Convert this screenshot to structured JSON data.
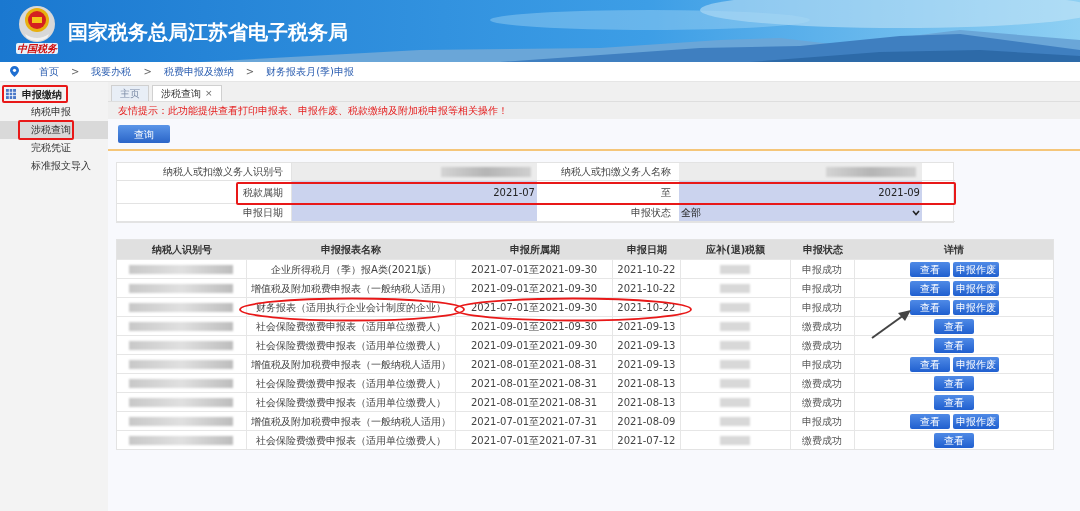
{
  "header": {
    "title": "国家税务总局江苏省电子税务局",
    "emblem_caption": "中国税务"
  },
  "breadcrumb": [
    {
      "label": "首页",
      "kind": "link"
    },
    {
      "label": ">",
      "kind": "separator"
    },
    {
      "label": "我要办税",
      "kind": "link"
    },
    {
      "label": ">",
      "kind": "separator"
    },
    {
      "label": "税费申报及缴纳",
      "kind": "link"
    },
    {
      "label": ">",
      "kind": "separator"
    },
    {
      "label": "财务报表月(季)申报",
      "kind": "link"
    }
  ],
  "sidebar": {
    "title": "申报缴纳",
    "items": [
      {
        "label": "纳税申报",
        "selected": false
      },
      {
        "label": "涉税查询",
        "selected": true
      },
      {
        "label": "完税凭证",
        "selected": false
      },
      {
        "label": "标准报文导入",
        "selected": false
      }
    ]
  },
  "tabs": [
    {
      "label": "主页",
      "selected": false
    },
    {
      "label": "涉税查询",
      "selected": true,
      "close": "×"
    }
  ],
  "notice": "友情提示：此功能提供查看打印申报表、申报作废、税款缴纳及附加税申报等相关操作！",
  "query_button": "查询",
  "form": {
    "rows": [
      [
        {
          "label": "纳税人或扣缴义务人识别号",
          "kind": "redacted"
        },
        {
          "label": "纳税人或扣缴义务人名称",
          "kind": "redacted"
        }
      ],
      [
        {
          "label": "税款属期",
          "kind": "input",
          "value": "2021-07"
        },
        {
          "label": "至",
          "kind": "input",
          "value": "2021-09"
        }
      ],
      [
        {
          "label": "申报日期",
          "kind": "input"
        },
        {
          "label": "申报状态",
          "kind": "select",
          "value": "全部"
        }
      ]
    ]
  },
  "table": {
    "columns": [
      "纳税人识别号",
      "申报报表名称",
      "申报所属期",
      "申报日期",
      "应补(退)税额",
      "申报状态",
      "详情"
    ],
    "rows": [
      {
        "name": "企业所得税月（季）报A类(2021版)",
        "period": "2021-07-01至2021-09-30",
        "date": "2021-10-22",
        "status": "申报成功",
        "buttons": [
          "查看",
          "申报作废"
        ]
      },
      {
        "name": "增值税及附加税费申报表（一般纳税人适用）",
        "period": "2021-09-01至2021-09-30",
        "date": "2021-10-22",
        "status": "申报成功",
        "buttons": [
          "查看",
          "申报作废"
        ]
      },
      {
        "name": "财务报表（适用执行企业会计制度的企业）",
        "period": "2021-07-01至2021-09-30",
        "date": "2021-10-22",
        "status": "申报成功",
        "buttons": [
          "查看",
          "申报作废"
        ]
      },
      {
        "name": "社会保险费缴费申报表（适用单位缴费人）",
        "period": "2021-09-01至2021-09-30",
        "date": "2021-09-13",
        "status": "缴费成功",
        "buttons": [
          "查看"
        ]
      },
      {
        "name": "社会保险费缴费申报表（适用单位缴费人）",
        "period": "2021-09-01至2021-09-30",
        "date": "2021-09-13",
        "status": "缴费成功",
        "buttons": [
          "查看"
        ]
      },
      {
        "name": "增值税及附加税费申报表（一般纳税人适用）",
        "period": "2021-08-01至2021-08-31",
        "date": "2021-09-13",
        "status": "申报成功",
        "buttons": [
          "查看",
          "申报作废"
        ]
      },
      {
        "name": "社会保险费缴费申报表（适用单位缴费人）",
        "period": "2021-08-01至2021-08-31",
        "date": "2021-08-13",
        "status": "缴费成功",
        "buttons": [
          "查看"
        ]
      },
      {
        "name": "社会保险费缴费申报表（适用单位缴费人）",
        "period": "2021-08-01至2021-08-31",
        "date": "2021-08-13",
        "status": "缴费成功",
        "buttons": [
          "查看"
        ]
      },
      {
        "name": "增值税及附加税费申报表（一般纳税人适用）",
        "period": "2021-07-01至2021-07-31",
        "date": "2021-08-09",
        "status": "申报成功",
        "buttons": [
          "查看",
          "申报作废"
        ]
      },
      {
        "name": "社会保险费缴费申报表（适用单位缴费人）",
        "period": "2021-07-01至2021-07-31",
        "date": "2021-07-12",
        "status": "缴费成功",
        "buttons": [
          "查看"
        ]
      }
    ]
  }
}
